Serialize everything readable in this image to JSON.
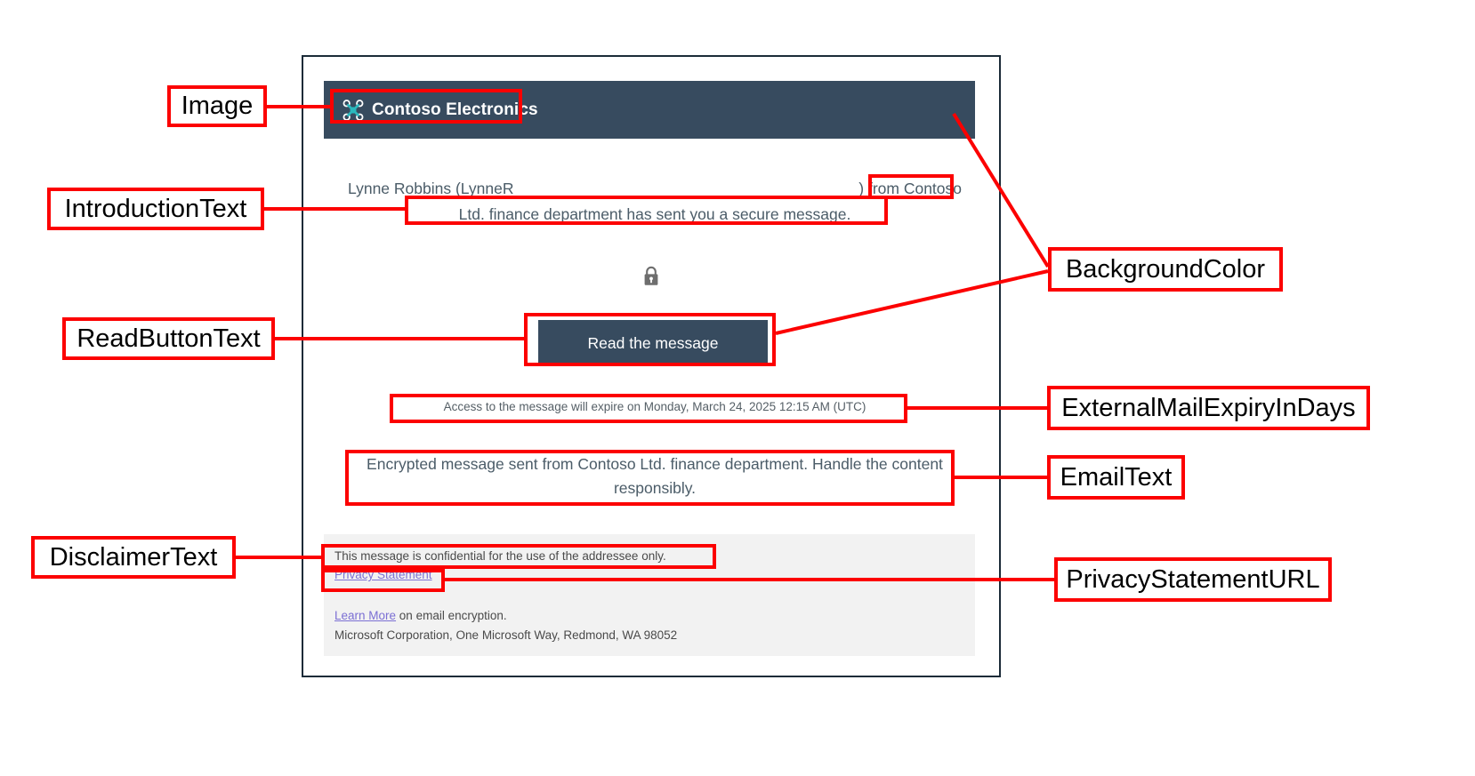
{
  "email": {
    "header": {
      "logo_icon": "contoso-drone-logo-icon",
      "company_name": "Contoso Electronics",
      "background_color": "#374B5F"
    },
    "introduction": {
      "line1_left": "Lynne Robbins (LynneR",
      "line1_right": ") from Contoso",
      "line2": "Ltd. finance department has sent you a secure message."
    },
    "lock_icon": "padlock-icon",
    "read_button": {
      "label": "Read the message",
      "background_color": "#374B5F"
    },
    "expiry": "Access to the message will expire on Monday, March 24, 2025 12:15 AM (UTC)",
    "body_text": "Encrypted message sent from Contoso Ltd. finance department. Handle the content responsibly.",
    "footer": {
      "disclaimer": "This message is confidential for the use of the addressee only.",
      "privacy_link": "Privacy Statement",
      "learn_more_link": "Learn More",
      "learn_more_suffix": " on email encryption.",
      "address": "Microsoft Corporation, One Microsoft Way, Redmond, WA 98052",
      "background_color": "#F2F2F2"
    }
  },
  "annotations": {
    "color": "#FC0000",
    "image": "Image",
    "introduction_text": "IntroductionText",
    "read_button_text": "ReadButtonText",
    "disclaimer_text": "DisclaimerText",
    "background_color": "BackgroundColor",
    "external_mail_expiry": "ExternalMailExpiryInDays",
    "email_text": "EmailText",
    "privacy_statement_url": "PrivacyStatementURL"
  }
}
